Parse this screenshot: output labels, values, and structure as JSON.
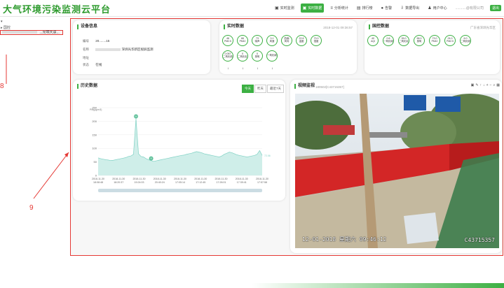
{
  "app": {
    "title": "大气环境污染监测云平台"
  },
  "nav": {
    "items": [
      {
        "label": "实时监测",
        "icon": "▣"
      },
      {
        "label": "实时数据",
        "icon": "▣"
      },
      {
        "label": "分析统计",
        "icon": "≡"
      },
      {
        "label": "排行榜",
        "icon": "▤"
      },
      {
        "label": "告警",
        "icon": "●"
      },
      {
        "label": "数据导出",
        "icon": "⇩"
      },
      {
        "label": "用户中心",
        "icon": "♟"
      }
    ],
    "active_index": 1,
    "user_name": "...........@有限公司",
    "badge": "退出"
  },
  "tree": {
    "root": "▾",
    "sub": "▸ 国控",
    "item_label": "...光明大道..."
  },
  "annotations": {
    "a8": "8",
    "a9": "9"
  },
  "device": {
    "title": "设备信息",
    "rows": [
      {
        "label": "编号",
        "value": "20........15"
      },
      {
        "label": "名称",
        "value": "深圳光华新区视屏监测"
      },
      {
        "label": "地址",
        "value": ""
      },
      {
        "label": "状态",
        "value": "在线"
      }
    ]
  },
  "realtime": {
    "title": "实时数据",
    "time": "2018-12-01 09:36:57",
    "gauges": [
      {
        "value": "46",
        "label": "PM2.5"
      },
      {
        "value": "66",
        "label": "PM10"
      },
      {
        "value": "73",
        "label": "噪声"
      },
      {
        "value": "3.1",
        "label": "风速"
      },
      {
        "value": "西南",
        "label": "风向"
      },
      {
        "value": "22.6",
        "label": "温度"
      },
      {
        "value": "73.0",
        "label": "湿度"
      },
      {
        "value": "",
        "label": "二氧化硫"
      },
      {
        "value": "",
        "label": "二氧化氮"
      },
      {
        "value": "0",
        "label": "臭氧"
      },
      {
        "value": "",
        "label": "一氧化碳"
      }
    ],
    "gauge_row2": [
      {
        "value": "0.067",
        "label": "二氧化硫"
      },
      {
        "value": "0",
        "label": "二氧化氮"
      },
      {
        "value": "0",
        "label": "臭氧"
      },
      {
        "value": "",
        "label": "一氧化碳"
      }
    ],
    "dir_icons": [
      "↓",
      "↓",
      "↓",
      "↓"
    ]
  },
  "national": {
    "title": "国控数据",
    "location": "广东省深圳光华区",
    "gauges": [
      {
        "value": "40",
        "label": "AQI"
      },
      {
        "value": "0.6",
        "label": "一氧化碳"
      },
      {
        "value": "35.0",
        "label": "二氧化氮"
      },
      {
        "value": "56.0",
        "label": "臭氧"
      },
      {
        "value": "73.0",
        "label": "PM10"
      },
      {
        "value": "24.0",
        "label": "PM2.5"
      },
      {
        "value": "6.0",
        "label": "二氧化硫"
      }
    ]
  },
  "history": {
    "title": "历史数据",
    "tabs": [
      "今天",
      "昨天",
      "最近7天"
    ],
    "active_tab": 0,
    "ylabel": "PM(μg/m3)"
  },
  "chart_data": {
    "type": "area",
    "title": "",
    "ylabel": "PM(μg/m3)",
    "ylim": [
      0,
      250
    ],
    "yticks": [
      "250",
      "200",
      "150",
      "100",
      "50",
      "0"
    ],
    "xticks": [
      "2018-11-30\n18:08:48",
      "2018-11-30\n18:20:37",
      "2018-11-30\n19:24:03",
      "2018-11-30\n20:40:24",
      "2018-11-30\n17:05:14",
      "2018-11-30\n17:12:45",
      "2018-11-30\n17:26:01",
      "2018-11-30\n17:39:41",
      "2018-11-30\n17:57:58"
    ],
    "series": [
      {
        "values": [
          65,
          62,
          60,
          58,
          57,
          55,
          56,
          58,
          60,
          62,
          64,
          66,
          70,
          72,
          78,
          210,
          80,
          70,
          68,
          62,
          58,
          55,
          52,
          54,
          56,
          58,
          60,
          62,
          64,
          66,
          68,
          70,
          72,
          74,
          75,
          78,
          80,
          82,
          85,
          88,
          86,
          84,
          80,
          78,
          76,
          74,
          72,
          70,
          68,
          72,
          78,
          82,
          86,
          84,
          80,
          76,
          74,
          72,
          70,
          68,
          70,
          72,
          74,
          78,
          92,
          74
        ]
      }
    ],
    "markers": [
      {
        "index": 15,
        "value": "210"
      },
      {
        "index": 21,
        "value": "55"
      }
    ],
    "end_label": "72.06"
  },
  "video": {
    "title": "视频监视",
    "cam_id": "180502[C43715357]",
    "osd_time": "12-01-2018  星期六  09:46:12",
    "osd_cam": "C43715357",
    "toolbar": [
      "▣",
      "✎",
      "↑",
      "↓",
      "+",
      "−",
      "⌕",
      "▦"
    ]
  }
}
